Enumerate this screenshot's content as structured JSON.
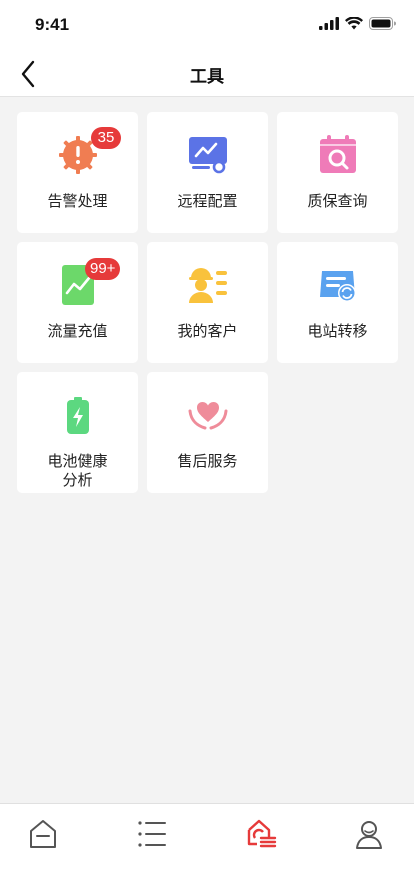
{
  "status_bar": {
    "time": "9:41"
  },
  "nav": {
    "title": "工具"
  },
  "tools": [
    {
      "label": "告警处理",
      "icon": "alarm-gear-icon",
      "badge": "35"
    },
    {
      "label": "远程配置",
      "icon": "remote-monitor-icon"
    },
    {
      "label": "质保查询",
      "icon": "calendar-search-icon"
    },
    {
      "label": "流量充值",
      "icon": "sim-card-chart-icon",
      "badge": "99+"
    },
    {
      "label": "我的客户",
      "icon": "customer-worker-icon"
    },
    {
      "label": "电站转移",
      "icon": "station-transfer-icon"
    },
    {
      "label": "电池健康分析",
      "icon": "battery-charge-icon"
    },
    {
      "label": "售后服务",
      "icon": "heart-hands-icon"
    }
  ],
  "tab_bar": {
    "items": [
      {
        "name": "home-tab",
        "icon": "home-icon"
      },
      {
        "name": "list-tab",
        "icon": "list-icon"
      },
      {
        "name": "tools-tab",
        "icon": "tools-icon",
        "active": true
      },
      {
        "name": "profile-tab",
        "icon": "user-icon"
      }
    ]
  },
  "colors": {
    "accent_red": "#e63a3a",
    "alarm_orange": "#f07d52",
    "remote_blue": "#5b73e6",
    "warranty_pink": "#ef7bb8",
    "traffic_green": "#6cd86a",
    "customer_yellow": "#f9c23c",
    "transfer_blue": "#5aa2ef",
    "battery_green": "#5cd880",
    "service_pink": "#ef8c9a"
  }
}
